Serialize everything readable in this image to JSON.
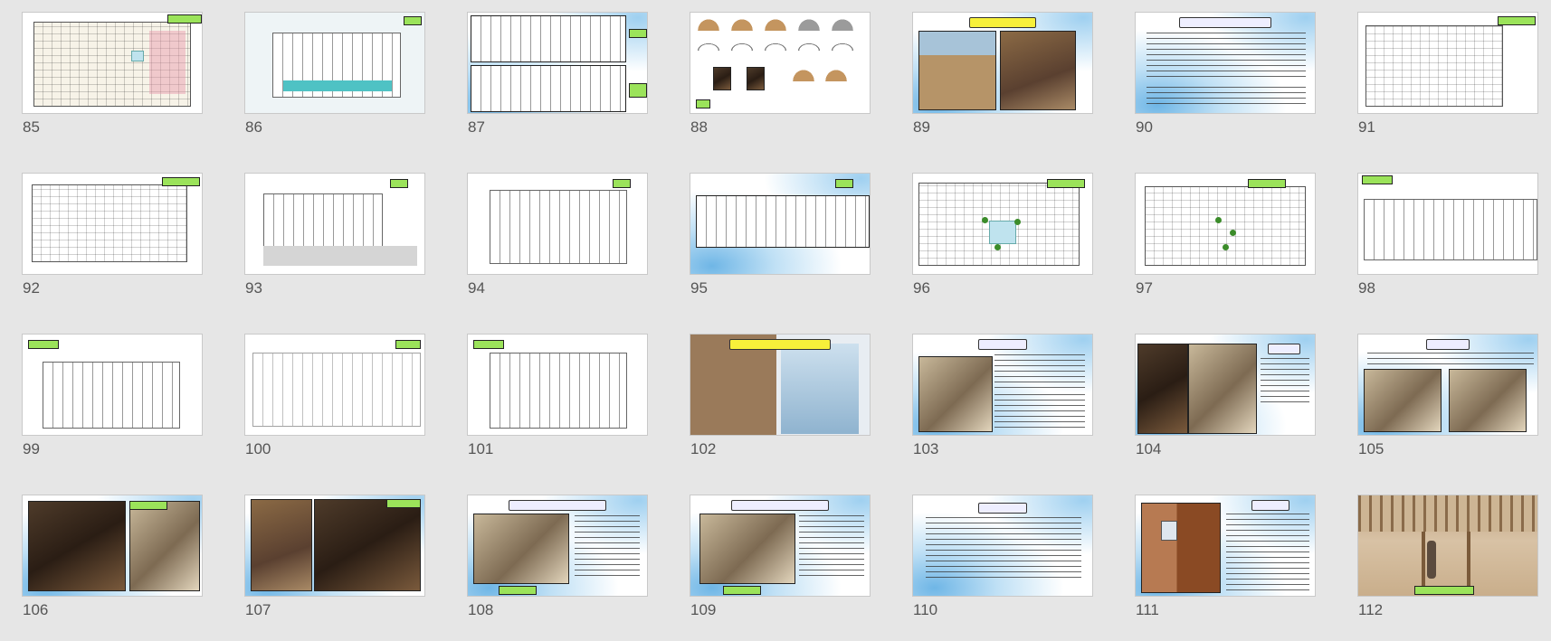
{
  "view": "slide-sorter",
  "slides": [
    {
      "number": "85"
    },
    {
      "number": "86"
    },
    {
      "number": "87"
    },
    {
      "number": "88"
    },
    {
      "number": "89"
    },
    {
      "number": "90"
    },
    {
      "number": "91"
    },
    {
      "number": "92"
    },
    {
      "number": "93"
    },
    {
      "number": "94"
    },
    {
      "number": "95"
    },
    {
      "number": "96"
    },
    {
      "number": "97"
    },
    {
      "number": "98"
    },
    {
      "number": "99"
    },
    {
      "number": "100"
    },
    {
      "number": "101"
    },
    {
      "number": "102"
    },
    {
      "number": "103"
    },
    {
      "number": "104"
    },
    {
      "number": "105"
    },
    {
      "number": "106"
    },
    {
      "number": "107"
    },
    {
      "number": "108"
    },
    {
      "number": "109"
    },
    {
      "number": "110"
    },
    {
      "number": "111"
    },
    {
      "number": "112"
    }
  ]
}
